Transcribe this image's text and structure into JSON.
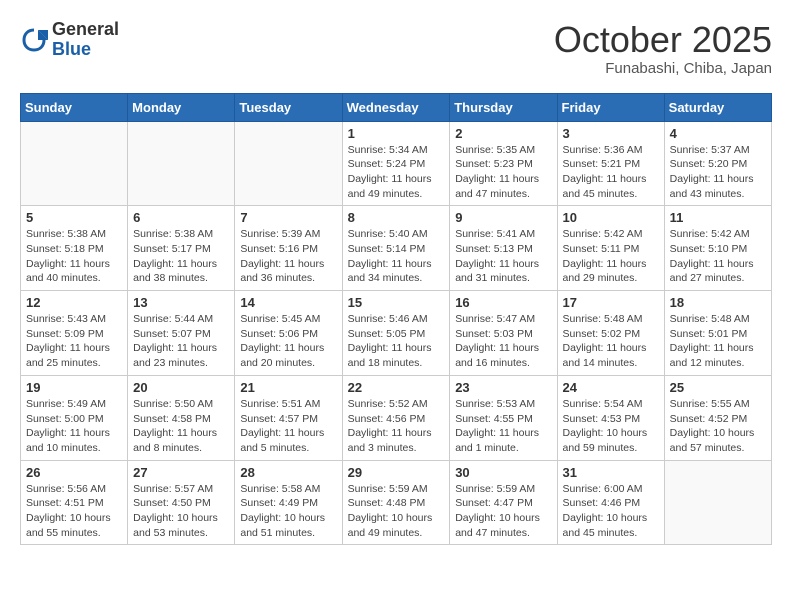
{
  "header": {
    "logo_general": "General",
    "logo_blue": "Blue",
    "month_title": "October 2025",
    "location": "Funabashi, Chiba, Japan"
  },
  "calendar": {
    "days_of_week": [
      "Sunday",
      "Monday",
      "Tuesday",
      "Wednesday",
      "Thursday",
      "Friday",
      "Saturday"
    ],
    "weeks": [
      [
        {
          "day": "",
          "info": ""
        },
        {
          "day": "",
          "info": ""
        },
        {
          "day": "",
          "info": ""
        },
        {
          "day": "1",
          "info": "Sunrise: 5:34 AM\nSunset: 5:24 PM\nDaylight: 11 hours\nand 49 minutes."
        },
        {
          "day": "2",
          "info": "Sunrise: 5:35 AM\nSunset: 5:23 PM\nDaylight: 11 hours\nand 47 minutes."
        },
        {
          "day": "3",
          "info": "Sunrise: 5:36 AM\nSunset: 5:21 PM\nDaylight: 11 hours\nand 45 minutes."
        },
        {
          "day": "4",
          "info": "Sunrise: 5:37 AM\nSunset: 5:20 PM\nDaylight: 11 hours\nand 43 minutes."
        }
      ],
      [
        {
          "day": "5",
          "info": "Sunrise: 5:38 AM\nSunset: 5:18 PM\nDaylight: 11 hours\nand 40 minutes."
        },
        {
          "day": "6",
          "info": "Sunrise: 5:38 AM\nSunset: 5:17 PM\nDaylight: 11 hours\nand 38 minutes."
        },
        {
          "day": "7",
          "info": "Sunrise: 5:39 AM\nSunset: 5:16 PM\nDaylight: 11 hours\nand 36 minutes."
        },
        {
          "day": "8",
          "info": "Sunrise: 5:40 AM\nSunset: 5:14 PM\nDaylight: 11 hours\nand 34 minutes."
        },
        {
          "day": "9",
          "info": "Sunrise: 5:41 AM\nSunset: 5:13 PM\nDaylight: 11 hours\nand 31 minutes."
        },
        {
          "day": "10",
          "info": "Sunrise: 5:42 AM\nSunset: 5:11 PM\nDaylight: 11 hours\nand 29 minutes."
        },
        {
          "day": "11",
          "info": "Sunrise: 5:42 AM\nSunset: 5:10 PM\nDaylight: 11 hours\nand 27 minutes."
        }
      ],
      [
        {
          "day": "12",
          "info": "Sunrise: 5:43 AM\nSunset: 5:09 PM\nDaylight: 11 hours\nand 25 minutes."
        },
        {
          "day": "13",
          "info": "Sunrise: 5:44 AM\nSunset: 5:07 PM\nDaylight: 11 hours\nand 23 minutes."
        },
        {
          "day": "14",
          "info": "Sunrise: 5:45 AM\nSunset: 5:06 PM\nDaylight: 11 hours\nand 20 minutes."
        },
        {
          "day": "15",
          "info": "Sunrise: 5:46 AM\nSunset: 5:05 PM\nDaylight: 11 hours\nand 18 minutes."
        },
        {
          "day": "16",
          "info": "Sunrise: 5:47 AM\nSunset: 5:03 PM\nDaylight: 11 hours\nand 16 minutes."
        },
        {
          "day": "17",
          "info": "Sunrise: 5:48 AM\nSunset: 5:02 PM\nDaylight: 11 hours\nand 14 minutes."
        },
        {
          "day": "18",
          "info": "Sunrise: 5:48 AM\nSunset: 5:01 PM\nDaylight: 11 hours\nand 12 minutes."
        }
      ],
      [
        {
          "day": "19",
          "info": "Sunrise: 5:49 AM\nSunset: 5:00 PM\nDaylight: 11 hours\nand 10 minutes."
        },
        {
          "day": "20",
          "info": "Sunrise: 5:50 AM\nSunset: 4:58 PM\nDaylight: 11 hours\nand 8 minutes."
        },
        {
          "day": "21",
          "info": "Sunrise: 5:51 AM\nSunset: 4:57 PM\nDaylight: 11 hours\nand 5 minutes."
        },
        {
          "day": "22",
          "info": "Sunrise: 5:52 AM\nSunset: 4:56 PM\nDaylight: 11 hours\nand 3 minutes."
        },
        {
          "day": "23",
          "info": "Sunrise: 5:53 AM\nSunset: 4:55 PM\nDaylight: 11 hours\nand 1 minute."
        },
        {
          "day": "24",
          "info": "Sunrise: 5:54 AM\nSunset: 4:53 PM\nDaylight: 10 hours\nand 59 minutes."
        },
        {
          "day": "25",
          "info": "Sunrise: 5:55 AM\nSunset: 4:52 PM\nDaylight: 10 hours\nand 57 minutes."
        }
      ],
      [
        {
          "day": "26",
          "info": "Sunrise: 5:56 AM\nSunset: 4:51 PM\nDaylight: 10 hours\nand 55 minutes."
        },
        {
          "day": "27",
          "info": "Sunrise: 5:57 AM\nSunset: 4:50 PM\nDaylight: 10 hours\nand 53 minutes."
        },
        {
          "day": "28",
          "info": "Sunrise: 5:58 AM\nSunset: 4:49 PM\nDaylight: 10 hours\nand 51 minutes."
        },
        {
          "day": "29",
          "info": "Sunrise: 5:59 AM\nSunset: 4:48 PM\nDaylight: 10 hours\nand 49 minutes."
        },
        {
          "day": "30",
          "info": "Sunrise: 5:59 AM\nSunset: 4:47 PM\nDaylight: 10 hours\nand 47 minutes."
        },
        {
          "day": "31",
          "info": "Sunrise: 6:00 AM\nSunset: 4:46 PM\nDaylight: 10 hours\nand 45 minutes."
        },
        {
          "day": "",
          "info": ""
        }
      ]
    ]
  }
}
